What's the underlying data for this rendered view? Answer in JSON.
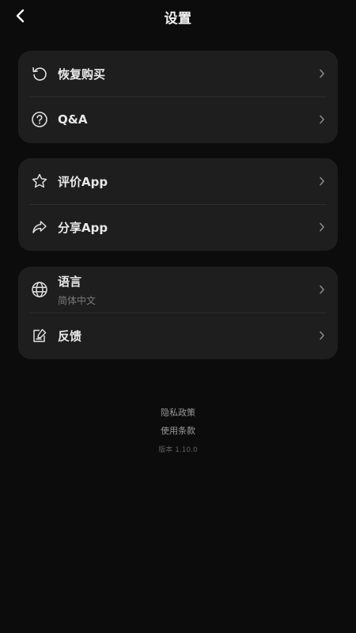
{
  "header": {
    "title": "设置",
    "back_icon": "chevron-left-icon"
  },
  "groups": [
    {
      "items": [
        {
          "label": "恢复购买",
          "icon": "restore-icon"
        },
        {
          "label": "Q&A",
          "icon": "help-circle-icon"
        }
      ]
    },
    {
      "items": [
        {
          "label": "评价App",
          "icon": "star-icon"
        },
        {
          "label": "分享App",
          "icon": "share-icon"
        }
      ]
    },
    {
      "items": [
        {
          "label": "语言",
          "sublabel": "简体中文",
          "icon": "globe-icon"
        },
        {
          "label": "反馈",
          "icon": "feedback-icon"
        }
      ]
    }
  ],
  "footer": {
    "privacy": "隐私政策",
    "terms": "使用条款",
    "version": "版本 1.10.0"
  },
  "colors": {
    "background": "#0c0c0c",
    "card": "#1e1e1e",
    "text": "#e8e8e8",
    "muted": "#7a7a7a"
  }
}
